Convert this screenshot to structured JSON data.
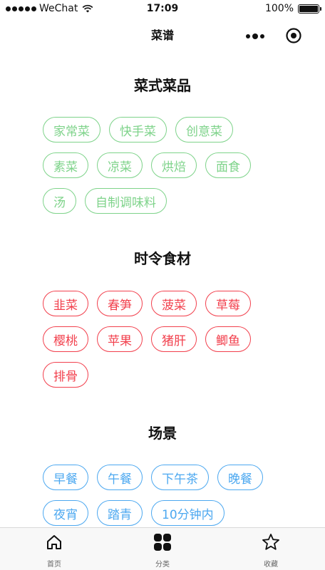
{
  "status_bar": {
    "carrier": "WeChat",
    "time": "17:09",
    "battery": "100%"
  },
  "nav": {
    "title": "菜谱"
  },
  "sections": [
    {
      "title": "菜式菜品",
      "color": "#7ed38a",
      "tags": [
        "家常菜",
        "快手菜",
        "创意菜",
        "素菜",
        "凉菜",
        "烘焙",
        "面食",
        "汤",
        "自制调味料"
      ]
    },
    {
      "title": "时令食材",
      "color": "#f2404d",
      "tags": [
        "韭菜",
        "春笋",
        "菠菜",
        "草莓",
        "樱桃",
        "苹果",
        "猪肝",
        "鲫鱼",
        "排骨"
      ]
    },
    {
      "title": "场景",
      "color": "#4ca8f0",
      "tags": [
        "早餐",
        "午餐",
        "下午茶",
        "晚餐",
        "夜宵",
        "踏青",
        "10分钟内"
      ]
    }
  ],
  "tab_bar": {
    "items": [
      {
        "label": "首页",
        "icon": "home-icon"
      },
      {
        "label": "分类",
        "icon": "grid-icon"
      },
      {
        "label": "收藏",
        "icon": "star-icon"
      }
    ]
  }
}
